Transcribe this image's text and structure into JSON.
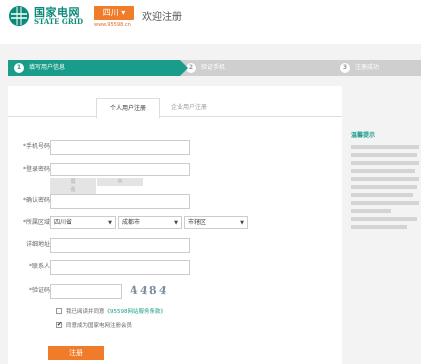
{
  "header": {
    "brand_cn": "国家电网",
    "brand_en": "STATE GRID",
    "region": "四川",
    "region_url": "www.95598.cn",
    "page_title": "欢迎注册"
  },
  "steps": [
    {
      "num": "1",
      "label": "填写用户信息"
    },
    {
      "num": "2",
      "label": "验证手机"
    },
    {
      "num": "3",
      "label": "注册成功"
    }
  ],
  "tabs": {
    "personal": "个人用户注册",
    "company": "企业用户注册"
  },
  "form": {
    "phone_label": "*手机号码:",
    "password_label": "*登录密码:",
    "strength": [
      "弱",
      "中",
      "强"
    ],
    "confirm_label": "*确认密码:",
    "region_label": "*所属区域:",
    "region_province": "四川省",
    "region_city": "成都市",
    "region_district": "市辖区",
    "address_label": "详细地址:",
    "contact_label": "*联系人:",
    "captcha_label": "*验证码:",
    "captcha_text": [
      "4",
      "4",
      "8",
      "4"
    ],
    "agree_text": "我已阅读并同意",
    "agree_link": "《95598网站服务条款》",
    "register_text": "同意成为国家电网注册会员",
    "submit_label": "注册"
  },
  "side": {
    "title": "温馨提示"
  },
  "colors": {
    "brand": "#1a9c8b",
    "accent": "#f07c2a"
  }
}
